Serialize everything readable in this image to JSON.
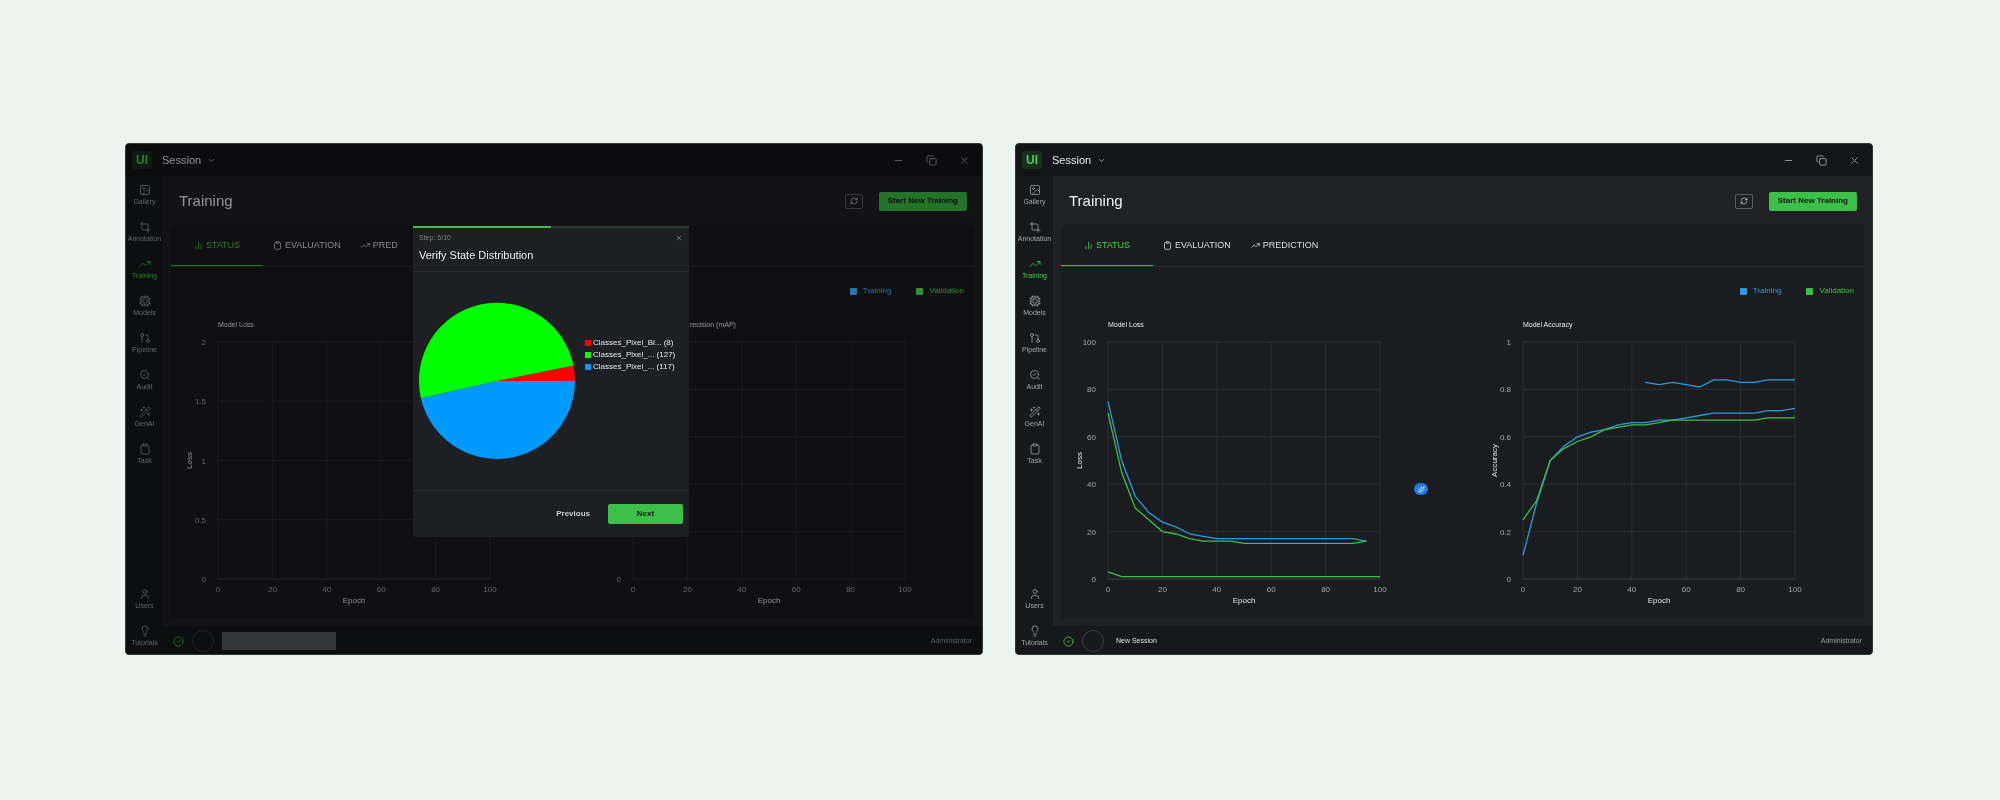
{
  "windows": [
    {
      "logo": "UI",
      "title": "Session",
      "sidebar": {
        "top": [
          {
            "label": "Gallery",
            "selected": false
          },
          {
            "label": "Annotation",
            "selected": false
          },
          {
            "label": "Training",
            "selected": true
          },
          {
            "label": "Models",
            "selected": false
          },
          {
            "label": "Pipeline",
            "selected": false
          },
          {
            "label": "Audit",
            "selected": false
          },
          {
            "label": "GenAI",
            "selected": false
          },
          {
            "label": "Task",
            "selected": false
          }
        ],
        "bottom": [
          {
            "label": "Users",
            "selected": false
          },
          {
            "label": "Tutorials",
            "selected": false
          }
        ]
      },
      "page_title": "Training",
      "start_button": "Start New Training",
      "tabs": [
        {
          "label": "STATUS",
          "selected": true
        },
        {
          "label": "EVALUATION",
          "selected": false
        },
        {
          "label": "PRED",
          "selected": false
        }
      ],
      "legend": [
        {
          "label": "Training",
          "color": "#2477aa"
        },
        {
          "label": "Validation",
          "color": "#2f9039"
        }
      ],
      "charts": [
        {
          "title": "Model Loss",
          "chart_data": {
            "type": "line",
            "xlabel": "Epoch",
            "ylabel": "Loss",
            "xlim": [
              0,
              100
            ],
            "ylim": [
              0,
              2
            ],
            "xticks": [
              0,
              20,
              40,
              60,
              80,
              100
            ],
            "yticks": [
              0,
              0.5,
              1,
              1.5,
              2
            ],
            "grid": true
          }
        },
        {
          "title": "recision (mAP)",
          "y_tick": "0",
          "x_ticks": [
            "0",
            "20",
            "40",
            "60",
            "80",
            "100"
          ],
          "x_axis_title": "Epoch"
        }
      ],
      "status_bar": {
        "user": "Administrator"
      },
      "modal": {
        "progress": {
          "level": 0.5
        },
        "step": "Step: 5/10",
        "title": "Verify State Distribution",
        "chart_data": {
          "type": "pie",
          "categories": [
            "Classes_Pixel_Bi... (8)",
            "Classes_Pixel_... (127)",
            "Classes_Pixel_... (117)"
          ],
          "values": [
            8,
            127,
            117
          ],
          "legend": "right",
          "colors": [
            "#ff0000",
            "#00ff00",
            "#0099ff"
          ]
        },
        "buttons": {
          "previous": "Previous",
          "next": "Next"
        }
      }
    },
    {
      "logo": "UI",
      "title": "Session",
      "sidebar": {
        "top": [
          {
            "label": "Gallery",
            "selected": false
          },
          {
            "label": "Annotation",
            "selected": false
          },
          {
            "label": "Training",
            "selected": true
          },
          {
            "label": "Models",
            "selected": false
          },
          {
            "label": "Pipeline",
            "selected": false
          },
          {
            "label": "Audit",
            "selected": false
          },
          {
            "label": "GenAI",
            "selected": false
          },
          {
            "label": "Task",
            "selected": false
          }
        ],
        "bottom": [
          {
            "label": "Users",
            "selected": false
          },
          {
            "label": "Tutorials",
            "selected": false
          }
        ]
      },
      "page_title": "Training",
      "start_button": "Start New Training",
      "tabs": [
        {
          "label": "STATUS",
          "selected": true
        },
        {
          "label": "EVALUATION",
          "selected": false
        },
        {
          "label": "PREDICTION",
          "selected": false
        }
      ],
      "legend": [
        {
          "label": "Training",
          "color": "#2b9be0"
        },
        {
          "label": "Validation",
          "color": "#3cc04a"
        }
      ],
      "charts": [
        {
          "title": "Model Loss",
          "chart_data": {
            "type": "line",
            "xlabel": "Epoch",
            "ylabel": "Loss",
            "xlim": [
              0,
              100
            ],
            "ylim": [
              0,
              100
            ],
            "xticks": [
              0,
              20,
              40,
              60,
              80,
              100
            ],
            "yticks": [
              0,
              20,
              40,
              60,
              80,
              100
            ],
            "grid": true,
            "x": [
              0,
              5,
              10,
              15,
              20,
              25,
              30,
              35,
              40,
              45,
              50,
              55,
              60,
              65,
              70,
              75,
              80,
              85,
              90,
              95,
              100
            ],
            "series": [
              {
                "color": "#2b9be0",
                "values": [
                  75,
                  50,
                  35,
                  28,
                  24,
                  22,
                  19,
                  18,
                  17,
                  17,
                  17,
                  17,
                  17,
                  17,
                  17,
                  17,
                  17,
                  17,
                  17,
                  16,
                  null
                ]
              },
              {
                "color": "#3cc04a",
                "values": [
                  70,
                  45,
                  30,
                  25,
                  20,
                  19,
                  17,
                  16,
                  16,
                  16,
                  15,
                  15,
                  15,
                  15,
                  15,
                  15,
                  15,
                  15,
                  15,
                  16,
                  null
                ]
              },
              {
                "color": "#3cc04a",
                "values": [
                  3,
                  1,
                  1,
                  1,
                  1,
                  1,
                  1,
                  1,
                  1,
                  1,
                  1,
                  1,
                  1,
                  1,
                  1,
                  1,
                  1,
                  1,
                  1,
                  1,
                  1
                ]
              }
            ]
          }
        },
        {
          "title": "Model Accuracy",
          "chart_data": {
            "type": "line",
            "xlabel": "Epoch",
            "ylabel": "Accuracy",
            "xlim": [
              0,
              100
            ],
            "ylim": [
              0,
              1
            ],
            "xticks": [
              0,
              20,
              40,
              60,
              80,
              100
            ],
            "yticks": [
              0,
              0.2,
              0.4,
              0.6,
              0.8,
              1
            ],
            "grid": true,
            "x": [
              0,
              5,
              10,
              15,
              20,
              25,
              30,
              35,
              40,
              45,
              50,
              55,
              60,
              65,
              70,
              75,
              80,
              85,
              90,
              95,
              100
            ],
            "series": [
              {
                "color": "#2b9be0",
                "values": [
                  0.1,
                  0.32,
                  0.5,
                  0.56,
                  0.6,
                  0.62,
                  0.63,
                  0.65,
                  0.66,
                  0.66,
                  0.67,
                  0.67,
                  0.68,
                  0.69,
                  0.7,
                  0.7,
                  0.7,
                  0.7,
                  0.71,
                  0.71,
                  0.72
                ]
              },
              {
                "color": "#3cc04a",
                "values": [
                  0.25,
                  0.33,
                  0.5,
                  0.55,
                  0.58,
                  0.6,
                  0.63,
                  0.64,
                  0.65,
                  0.65,
                  0.66,
                  0.67,
                  0.67,
                  0.67,
                  0.67,
                  0.67,
                  0.67,
                  0.67,
                  0.68,
                  0.68,
                  0.68
                ]
              },
              {
                "color": "#2b9be0",
                "values": [
                  null,
                  null,
                  null,
                  null,
                  null,
                  null,
                  null,
                  null,
                  null,
                  0.83,
                  0.82,
                  0.83,
                  0.82,
                  0.81,
                  0.84,
                  0.84,
                  0.83,
                  0.83,
                  0.84,
                  0.84,
                  0.84
                ]
              }
            ]
          }
        }
      ],
      "status_bar": {
        "session": "New Session",
        "user": "Administrator"
      }
    }
  ]
}
